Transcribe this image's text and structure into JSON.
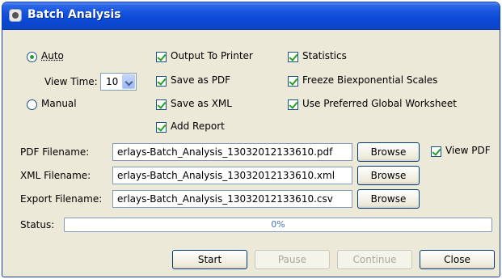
{
  "window": {
    "title": "Batch Analysis"
  },
  "mode": {
    "auto_label": "Auto",
    "manual_label": "Manual",
    "selected": "Auto",
    "view_time_label": "View Time:",
    "view_time_value": "10"
  },
  "options": {
    "output_to_printer": {
      "label": "Output To Printer",
      "checked": true
    },
    "save_as_pdf": {
      "label": "Save as PDF",
      "checked": true
    },
    "save_as_xml": {
      "label": "Save as XML",
      "checked": true
    },
    "add_report": {
      "label": "Add Report",
      "checked": true
    },
    "statistics": {
      "label": "Statistics",
      "checked": true
    },
    "freeze_scales": {
      "label": "Freeze Biexponential Scales",
      "checked": true
    },
    "use_global_worksheet": {
      "label": "Use Preferred Global Worksheet",
      "checked": true
    }
  },
  "files": {
    "pdf_label": "PDF Filename:",
    "pdf_value": "erlays-Batch_Analysis_13032012133610.pdf",
    "xml_label": "XML Filename:",
    "xml_value": "erlays-Batch_Analysis_13032012133610.xml",
    "export_label": "Export Filename:",
    "export_value": "erlays-Batch_Analysis_13032012133610.csv",
    "browse_label": "Browse",
    "view_pdf_label": "View PDF",
    "view_pdf_checked": true
  },
  "status": {
    "label": "Status:",
    "progress_text": "0%",
    "progress_fraction": 0.0
  },
  "buttons": {
    "start": "Start",
    "pause": "Pause",
    "continue": "Continue",
    "close": "Close"
  },
  "colors": {
    "titlebar": "#0a48d4",
    "check": "#21a121",
    "radio_dot": "#2c9a3a",
    "panel": "#ece9d8"
  }
}
